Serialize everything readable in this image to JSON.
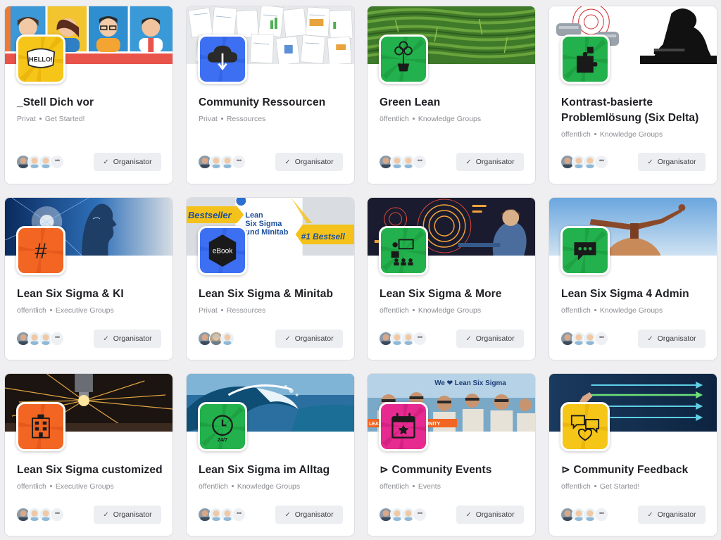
{
  "button_label": "Organisator",
  "more_label": "•••",
  "cards": [
    {
      "title": "_Stell Dich vor",
      "privacy": "Privat",
      "category": "Get Started!",
      "logo_color": "#f5c518",
      "logo_icon": "hello-badge-icon",
      "banner": "avatars-banner"
    },
    {
      "title": "Community Ressourcen",
      "privacy": "Privat",
      "category": "Ressources",
      "logo_color": "#3d6ff2",
      "logo_icon": "cloud-download-icon",
      "banner": "documents-banner"
    },
    {
      "title": "Green Lean",
      "privacy": "öffentlich",
      "category": "Knowledge Groups",
      "logo_color": "#22b14c",
      "logo_icon": "plant-icon",
      "banner": "maze-banner"
    },
    {
      "title": "Kontrast-basierte Problemlösung (Six Delta)",
      "privacy": "öffentlich",
      "category": "Knowledge Groups",
      "logo_color": "#22b14c",
      "logo_icon": "puzzle-icon",
      "banner": "detective-banner"
    },
    {
      "title": "Lean Six Sigma & KI",
      "privacy": "öffentlich",
      "category": "Executive Groups",
      "logo_color": "#f26522",
      "logo_icon": "hashtag-icon",
      "banner": "ai-face-banner"
    },
    {
      "title": "Lean Six Sigma & Minitab",
      "privacy": "Privat",
      "category": "Ressources",
      "logo_color": "#3d6ff2",
      "logo_icon": "ebook-icon",
      "banner": "bestseller-banner"
    },
    {
      "title": "Lean Six Sigma & More",
      "privacy": "öffentlich",
      "category": "Knowledge Groups",
      "logo_color": "#22b14c",
      "logo_icon": "presentation-icon",
      "banner": "control-room-banner"
    },
    {
      "title": "Lean Six Sigma 4 Admin",
      "privacy": "öffentlich",
      "category": "Knowledge Groups",
      "logo_color": "#22b14c",
      "logo_icon": "chat-bubble-icon",
      "banner": "balance-banner"
    },
    {
      "title": "Lean Six Sigma customized",
      "privacy": "öffentlich",
      "category": "Executive Groups",
      "logo_color": "#f26522",
      "logo_icon": "factory-icon",
      "banner": "sparks-banner"
    },
    {
      "title": "Lean Six Sigma im Alltag",
      "privacy": "öffentlich",
      "category": "Knowledge Groups",
      "logo_color": "#22b14c",
      "logo_icon": "24-7-icon",
      "banner": "wave-banner"
    },
    {
      "title": "⊳ Community Events",
      "privacy": "öffentlich",
      "category": "Events",
      "logo_color": "#e62a8f",
      "logo_icon": "calendar-star-icon",
      "banner": "we-love-lss-banner",
      "banner_text": "We ❤ Lean Six Sigma",
      "banner_strip_text": "LEAN SIX SIGMA COMMUNITY"
    },
    {
      "title": "⊳ Community Feedback",
      "privacy": "öffentlich",
      "category": "Get Started!",
      "logo_color": "#f5c518",
      "logo_icon": "feedback-icon",
      "banner": "arrows-banner"
    }
  ],
  "banner_texts": {
    "bestseller_left": "Bestseller",
    "bestseller_right": "#1 Bestsell",
    "book_title_1": "Lean",
    "book_title_2": "Six Sigma",
    "book_title_3": "und Minitab",
    "hello": "HELLO!",
    "ebook": "eBook",
    "247": "24/7"
  }
}
